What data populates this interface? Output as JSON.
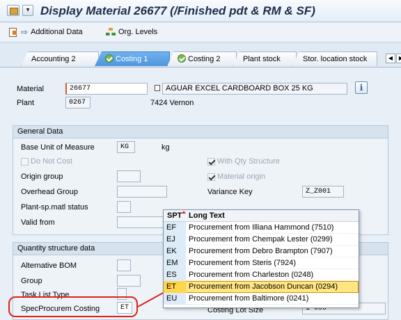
{
  "title": "Display Material 26677 (/Finished pdt & RM & SF)",
  "toolbar": {
    "additional_data": "Additional Data",
    "org_levels": "Org. Levels"
  },
  "tabs": [
    "Accounting 2",
    "Costing 1",
    "Costing 2",
    "Plant stock",
    "Stor. location stock"
  ],
  "header": {
    "material_label": "Material",
    "material_value": "26677",
    "material_desc": "AGUAR EXCEL CARDBOARD BOX 25 KG",
    "plant_label": "Plant",
    "plant_value": "0267",
    "plant_desc": "7424 Vernon"
  },
  "general": {
    "title": "General Data",
    "base_uom_label": "Base Unit of Measure",
    "base_uom_value": "KG",
    "base_uom_text": "kg",
    "do_not_cost": "Do Not Cost",
    "with_qty_structure": "With Qty Structure",
    "origin_group": "Origin group",
    "material_origin": "Material origin",
    "overhead_group": "Overhead Group",
    "variance_key_label": "Variance Key",
    "variance_key_value": "Z_Z001",
    "plant_sp_status": "Plant-sp.matl status",
    "valid_from": "Valid from"
  },
  "qty": {
    "title": "Quantity structure data",
    "alt_bom": "Alternative BOM",
    "group": "Group",
    "task_list_type": "Task List Type",
    "spec_procurem_label": "SpecProcurem Costing",
    "spec_procurem_value": "ET",
    "costing_lot_size_label": "Costing Lot Size",
    "costing_lot_size_value": "1 000"
  },
  "popup": {
    "col1": "SPT",
    "col2": "Long Text",
    "rows": [
      {
        "code": "EF",
        "text": "Procurement from Illiana Hammond (7510)"
      },
      {
        "code": "EJ",
        "text": "Procurement from Chempak Lester (0299)"
      },
      {
        "code": "EK",
        "text": "Procurement from Debro Brampton (7907)"
      },
      {
        "code": "EM",
        "text": "Procurement from Steris (7924)"
      },
      {
        "code": "ES",
        "text": "Procurement from Charleston (0248)"
      },
      {
        "code": "ET",
        "text": "Procurement from Jacobson Duncan (0294)"
      },
      {
        "code": "EU",
        "text": "Procurement from Baltimore (0241)"
      }
    ]
  }
}
